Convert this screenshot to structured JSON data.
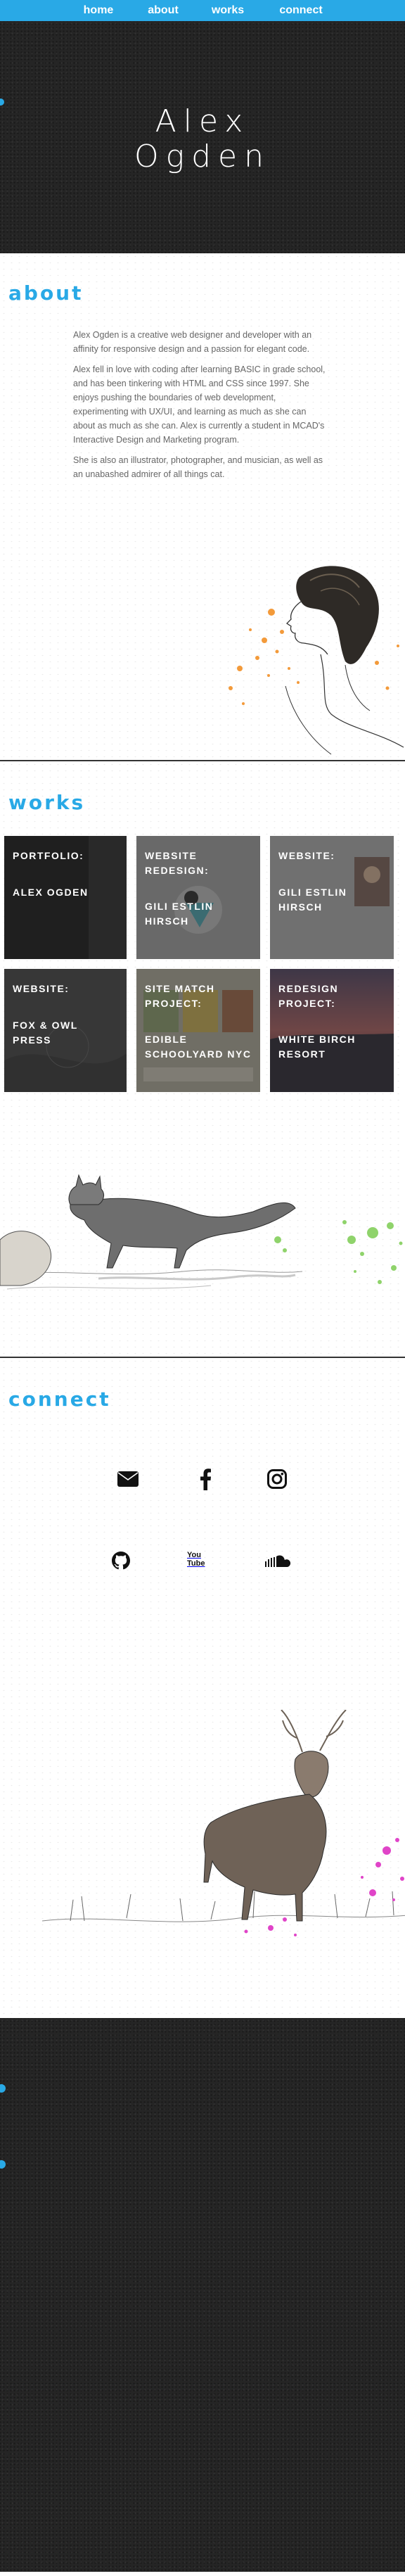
{
  "nav": {
    "items": [
      {
        "label": "home"
      },
      {
        "label": "about"
      },
      {
        "label": "works"
      },
      {
        "label": "connect"
      }
    ]
  },
  "hero": {
    "title_line1": "Alex",
    "title_line2": "Ogden"
  },
  "about": {
    "heading": "about",
    "paragraphs": [
      "Alex Ogden is a creative web designer and developer with an affinity for responsive design and a passion for elegant code.",
      "Alex fell in love with coding after learning BASIC in grade school, and has been tinkering with HTML and CSS since 1997. She enjoys pushing the boundaries of web development, experimenting with UX/UI, and learning as much as she can about as much as she can. Alex is currently a student in MCAD's Interactive Design and Marketing program.",
      "She is also an illustrator, photographer, and musician, as well as an unabashed admirer of all things cat."
    ]
  },
  "works": {
    "heading": "works",
    "tiles": [
      {
        "line1": "PORTFOLIO:",
        "line2": "ALEX OGDEN"
      },
      {
        "line1": "WEBSITE REDESIGN:",
        "line2": "GILI ESTLIN HIRSCH"
      },
      {
        "line1": "WEBSITE:",
        "line2": "GILI ESTLIN HIRSCH"
      },
      {
        "line1": "WEBSITE:",
        "line2": "FOX & OWL PRESS"
      },
      {
        "line1": "SITE MATCH PROJECT:",
        "line2": "EDIBLE SCHOOLYARD NYC"
      },
      {
        "line1": "REDESIGN PROJECT:",
        "line2": "WHITE BIRCH RESORT"
      }
    ]
  },
  "connect": {
    "heading": "connect",
    "links": [
      {
        "icon": "envelope-icon"
      },
      {
        "icon": "facebook-icon"
      },
      {
        "icon": "instagram-icon"
      },
      {
        "icon": "github-icon"
      },
      {
        "icon": "youtube-icon",
        "label": "You Tube"
      },
      {
        "icon": "soundcloud-icon"
      }
    ]
  },
  "colors": {
    "accent": "#29a9e6",
    "dark_bg": "#252525"
  }
}
